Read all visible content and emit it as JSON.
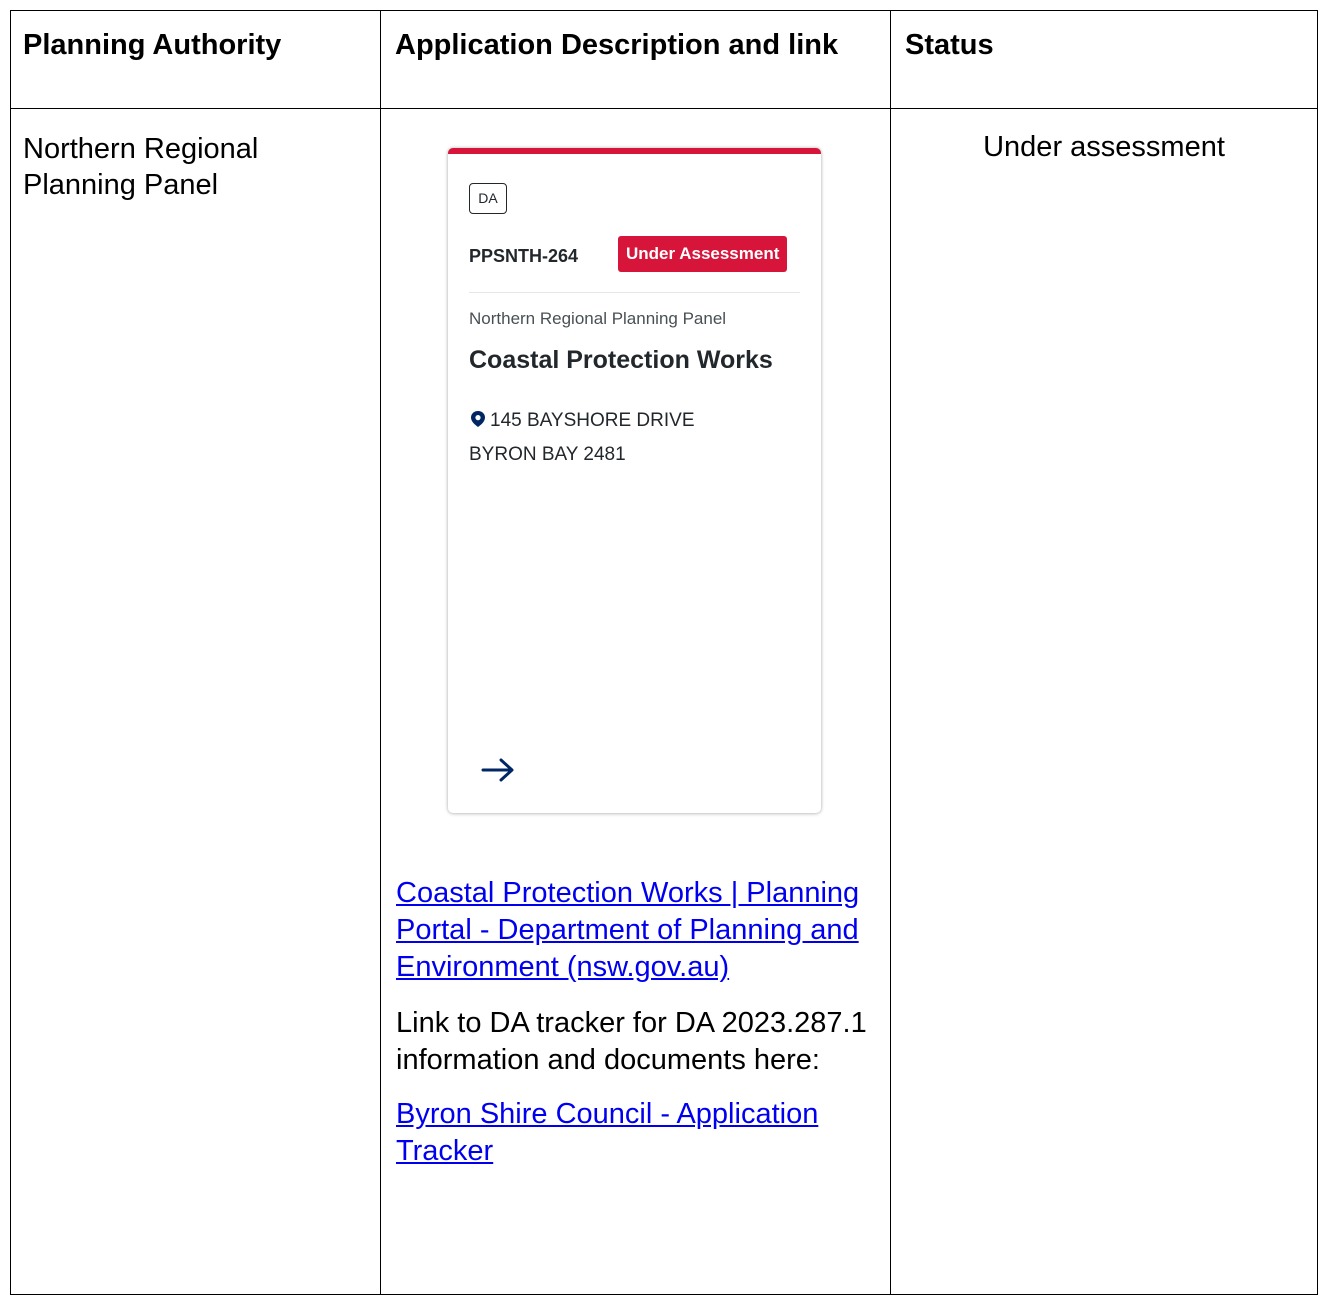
{
  "table": {
    "headers": {
      "authority": "Planning Authority",
      "description": "Application Description and link",
      "status": "Status"
    },
    "row": {
      "authority": "Northern Regional Planning Panel",
      "status": "Under assessment"
    }
  },
  "card": {
    "type_tag": "DA",
    "id": "PPSNTH-264",
    "badge": "Under Assessment",
    "authority": "Northern Regional Planning Panel",
    "title": "Coastal Protection Works",
    "address_line1": "145 BAYSHORE DRIVE",
    "address_line2": "BYRON BAY 2481",
    "accent_color": "#d7153a",
    "icons": [
      "location-pin-icon",
      "arrow-right-icon"
    ]
  },
  "links": {
    "portal_link": "Coastal Protection Works | Planning Portal - Department of Planning and Environment (nsw.gov.au)",
    "tracker_text": "Link to DA tracker for DA 2023.287.1 information and documents here:",
    "tracker_link": "Byron Shire Council - Application Tracker",
    "link_color": "#0000ee"
  }
}
